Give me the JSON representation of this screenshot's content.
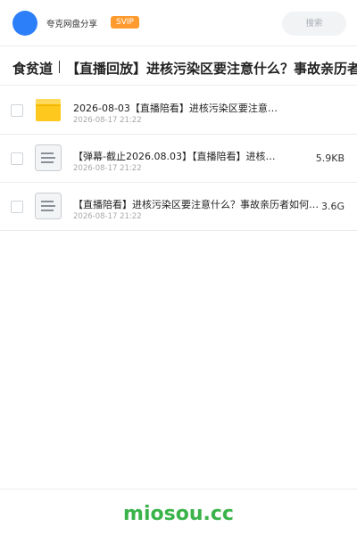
{
  "header": {
    "app_name": "夸克网盘分享",
    "badge": "SVIP",
    "search_label": "搜索"
  },
  "breadcrumb": {
    "root": "食贫道",
    "title": "【直播回放】进核污染区要注意什么？事故亲历者"
  },
  "files": [
    {
      "type": "folder",
      "icon": "folder-icon",
      "name": "2026-08-03【直播陪看】进核污染区要注意什…",
      "date": "2026-08-17 21:22",
      "size": ""
    },
    {
      "type": "document",
      "icon": "document-icon",
      "name": "【弹幕-截止2026.08.03】【直播陪看】进核…",
      "date": "2026-08-17 21:22",
      "size": "5.9KB"
    },
    {
      "type": "document",
      "icon": "document-icon",
      "name": "【直播陪看】进核污染区要注意什么？事故亲历者如何看…",
      "date": "2026-08-17 21:22",
      "size": "3.6G"
    }
  ],
  "watermark": "miosou.cc",
  "colors": {
    "avatar": "#2d7ff9",
    "svip": "#ff9a2e",
    "folder": "#ffc81e",
    "watermark": "#3ab34a"
  }
}
